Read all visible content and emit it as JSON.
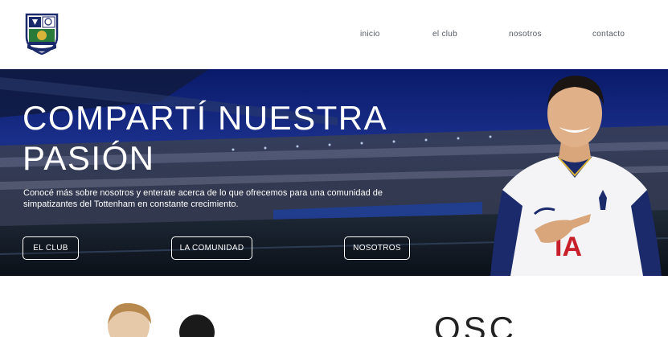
{
  "header": {
    "logo_icon": "club-crest-icon",
    "nav": [
      {
        "label": "inicio"
      },
      {
        "label": "el club"
      },
      {
        "label": "nosotros"
      },
      {
        "label": "contacto"
      }
    ]
  },
  "hero": {
    "title": "COMPARTÍ NUESTRA PASIÓN",
    "description": "Conocé más sobre nosotros y enterate acerca de lo que ofrecemos para una comunidad de simpatizantes del Tottenham en constante crecimiento.",
    "buttons": [
      {
        "label": "EL CLUB"
      },
      {
        "label": "LA COMUNIDAD"
      },
      {
        "label": "NOSOTROS"
      }
    ]
  },
  "section": {
    "heading": "OSC"
  },
  "colors": {
    "hero_bg": "#0b1540",
    "nav_text": "#555a64",
    "crest_navy": "#1b2a6b",
    "crest_yellow": "#d9b43a"
  }
}
